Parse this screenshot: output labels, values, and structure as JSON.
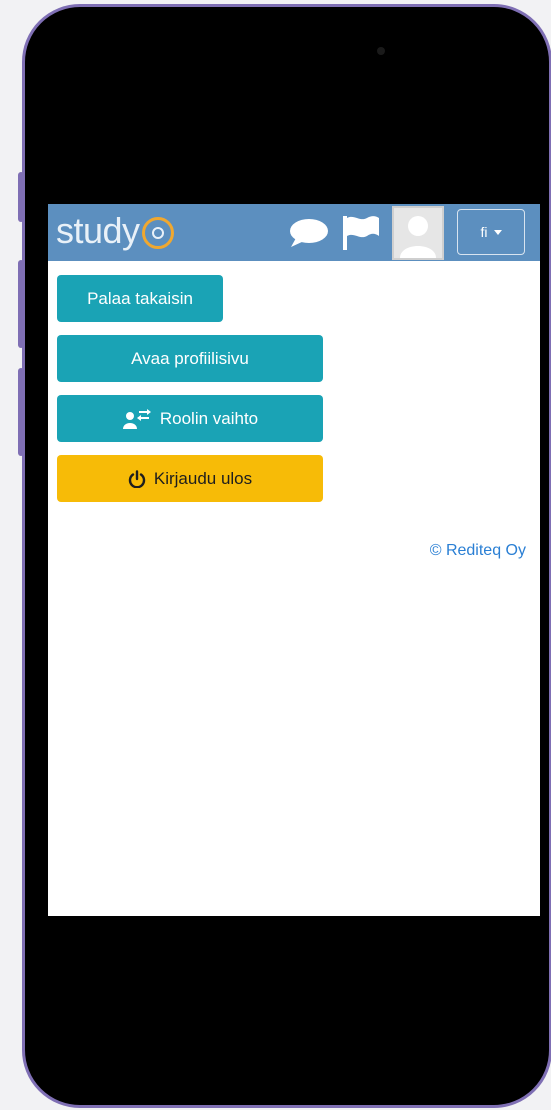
{
  "header": {
    "logo_text": "study",
    "lang_label": "fi",
    "icons": [
      "chat-bubble-icon",
      "flag-icon",
      "avatar-placeholder",
      "caret-down-icon"
    ],
    "color": "#5c8fbf"
  },
  "menu": {
    "back_label": "Palaa takaisin",
    "profile_label": "Avaa profiilisivu",
    "role_label": "Roolin vaihto",
    "logout_label": "Kirjaudu ulos",
    "teal_color": "#1aa3b5",
    "yellow_color": "#f7bb07"
  },
  "footer": {
    "copyright": "© Rediteq Oy"
  }
}
